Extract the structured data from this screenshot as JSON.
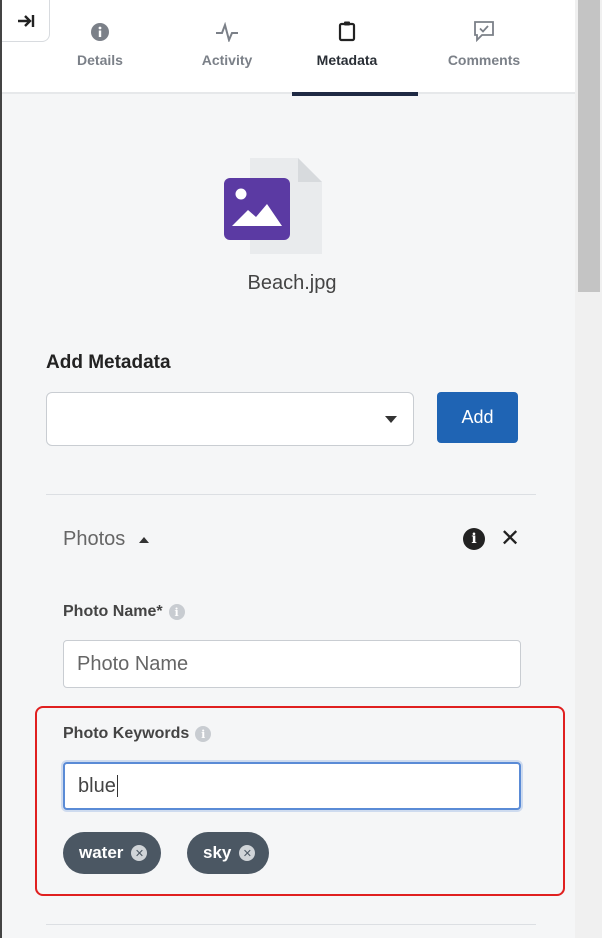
{
  "tabs": [
    {
      "label": "Details",
      "icon": "info-circle-icon"
    },
    {
      "label": "Activity",
      "icon": "activity-pulse-icon"
    },
    {
      "label": "Metadata",
      "icon": "clipboard-icon",
      "active": true
    },
    {
      "label": "Comments",
      "icon": "comment-check-icon"
    }
  ],
  "file": {
    "name": "Beach.jpg",
    "icon": "image-file-icon",
    "accent": "#5b3aa3"
  },
  "add_metadata": {
    "title": "Add Metadata",
    "select_value": "",
    "add_label": "Add"
  },
  "section": {
    "title": "Photos"
  },
  "fields": {
    "photo_name": {
      "label": "Photo Name*",
      "value": "",
      "placeholder": "Photo Name"
    },
    "photo_keywords": {
      "label": "Photo Keywords",
      "value": "blue"
    }
  },
  "keywords": [
    "water",
    "sky"
  ],
  "colors": {
    "primary": "#1f64b4",
    "highlight": "#e02020",
    "chip": "#4b5763",
    "active_tab": "#1f2a44"
  }
}
